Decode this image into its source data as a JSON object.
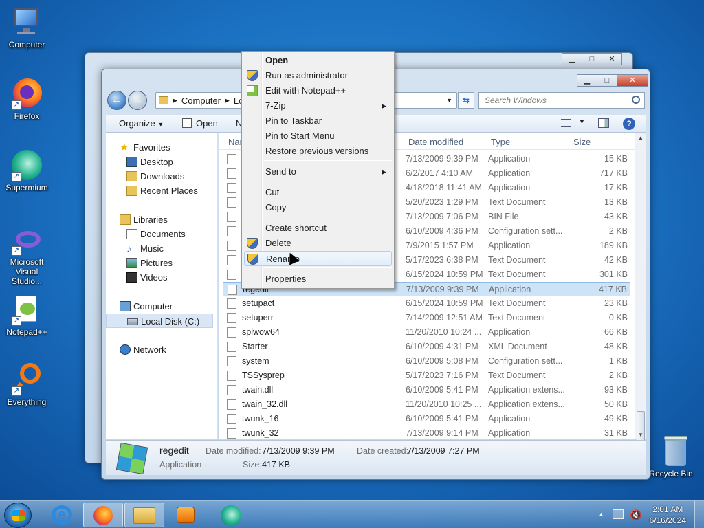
{
  "desktop": {
    "icons": [
      {
        "label": "Computer",
        "icon": "computer-icon"
      },
      {
        "label": "Firefox",
        "icon": "firefox-icon"
      },
      {
        "label": "Supermium",
        "icon": "supermium-icon"
      },
      {
        "label": "Microsoft Visual Studio...",
        "icon": "visual-studio-icon"
      },
      {
        "label": "Notepad++",
        "icon": "notepadpp-icon"
      },
      {
        "label": "Everything",
        "icon": "everything-icon"
      },
      {
        "label": "Recycle Bin",
        "icon": "recycle-bin-icon"
      }
    ]
  },
  "explorer": {
    "breadcrumb": [
      "Computer",
      "Lo"
    ],
    "search_placeholder": "Search Windows",
    "toolbar": {
      "organize": "Organize",
      "open": "Open",
      "more": "N"
    },
    "nav": {
      "favorites": "Favorites",
      "fav_items": [
        "Desktop",
        "Downloads",
        "Recent Places"
      ],
      "libraries": "Libraries",
      "lib_items": [
        "Documents",
        "Music",
        "Pictures",
        "Videos"
      ],
      "computer": "Computer",
      "computer_items": [
        "Local Disk (C:)"
      ],
      "network": "Network"
    },
    "columns": {
      "name": "Nam",
      "date": "Date modified",
      "type": "Type",
      "size": "Size"
    },
    "rows": [
      {
        "name": "",
        "date": "7/13/2009 9:39 PM",
        "type": "Application",
        "size": "15 KB"
      },
      {
        "name": "",
        "date": "6/2/2017 4:10 AM",
        "type": "Application",
        "size": "717 KB"
      },
      {
        "name": "",
        "date": "4/18/2018 11:41 AM",
        "type": "Application",
        "size": "17 KB"
      },
      {
        "name": "",
        "date": "5/20/2023 1:29 PM",
        "type": "Text Document",
        "size": "13 KB"
      },
      {
        "name": "",
        "date": "7/13/2009 7:06 PM",
        "type": "BIN File",
        "size": "43 KB"
      },
      {
        "name": "",
        "date": "6/10/2009 4:36 PM",
        "type": "Configuration sett...",
        "size": "2 KB"
      },
      {
        "name": "",
        "date": "7/9/2015 1:57 PM",
        "type": "Application",
        "size": "189 KB"
      },
      {
        "name": "",
        "date": "5/17/2023 6:38 PM",
        "type": "Text Document",
        "size": "42 KB"
      },
      {
        "name": "",
        "date": "6/15/2024 10:59 PM",
        "type": "Text Document",
        "size": "301 KB"
      },
      {
        "name": "regedit",
        "date": "7/13/2009 9:39 PM",
        "type": "Application",
        "size": "417 KB"
      },
      {
        "name": "setupact",
        "date": "6/15/2024 10:59 PM",
        "type": "Text Document",
        "size": "23 KB"
      },
      {
        "name": "setuperr",
        "date": "7/14/2009 12:51 AM",
        "type": "Text Document",
        "size": "0 KB"
      },
      {
        "name": "splwow64",
        "date": "11/20/2010 10:24 ...",
        "type": "Application",
        "size": "66 KB"
      },
      {
        "name": "Starter",
        "date": "6/10/2009 4:31 PM",
        "type": "XML Document",
        "size": "48 KB"
      },
      {
        "name": "system",
        "date": "6/10/2009 5:08 PM",
        "type": "Configuration sett...",
        "size": "1 KB"
      },
      {
        "name": "TSSysprep",
        "date": "5/17/2023 7:16 PM",
        "type": "Text Document",
        "size": "2 KB"
      },
      {
        "name": "twain.dll",
        "date": "6/10/2009 5:41 PM",
        "type": "Application extens...",
        "size": "93 KB"
      },
      {
        "name": "twain_32.dll",
        "date": "11/20/2010 10:25 ...",
        "type": "Application extens...",
        "size": "50 KB"
      },
      {
        "name": "twunk_16",
        "date": "6/10/2009 5:41 PM",
        "type": "Application",
        "size": "49 KB"
      },
      {
        "name": "twunk_32",
        "date": "7/13/2009 9:14 PM",
        "type": "Application",
        "size": "31 KB"
      }
    ],
    "selected_row": 9,
    "details": {
      "name": "regedit",
      "kind": "Application",
      "date_modified_label": "Date modified:",
      "date_modified": "7/13/2009 9:39 PM",
      "date_created_label": "Date created:",
      "date_created": "7/13/2009 7:27 PM",
      "size_label": "Size:",
      "size": "417 KB"
    }
  },
  "context_menu": {
    "items": [
      {
        "label": "Open",
        "bold": true
      },
      {
        "label": "Run as administrator",
        "icon": "uac-shield-icon"
      },
      {
        "label": "Edit with Notepad++",
        "icon": "notepadpp-icon"
      },
      {
        "label": "7-Zip",
        "submenu": true
      },
      {
        "label": "Pin to Taskbar"
      },
      {
        "label": "Pin to Start Menu"
      },
      {
        "label": "Restore previous versions"
      },
      {
        "label": "Send to",
        "submenu": true
      },
      {
        "label": "Cut"
      },
      {
        "label": "Copy"
      },
      {
        "label": "Create shortcut"
      },
      {
        "label": "Delete",
        "icon": "uac-shield-icon"
      },
      {
        "label": "Rename",
        "icon": "uac-shield-icon",
        "hovered": true
      },
      {
        "label": "Properties"
      }
    ]
  },
  "taskbar": {
    "time": "2:01 AM",
    "date": "6/16/2024"
  }
}
